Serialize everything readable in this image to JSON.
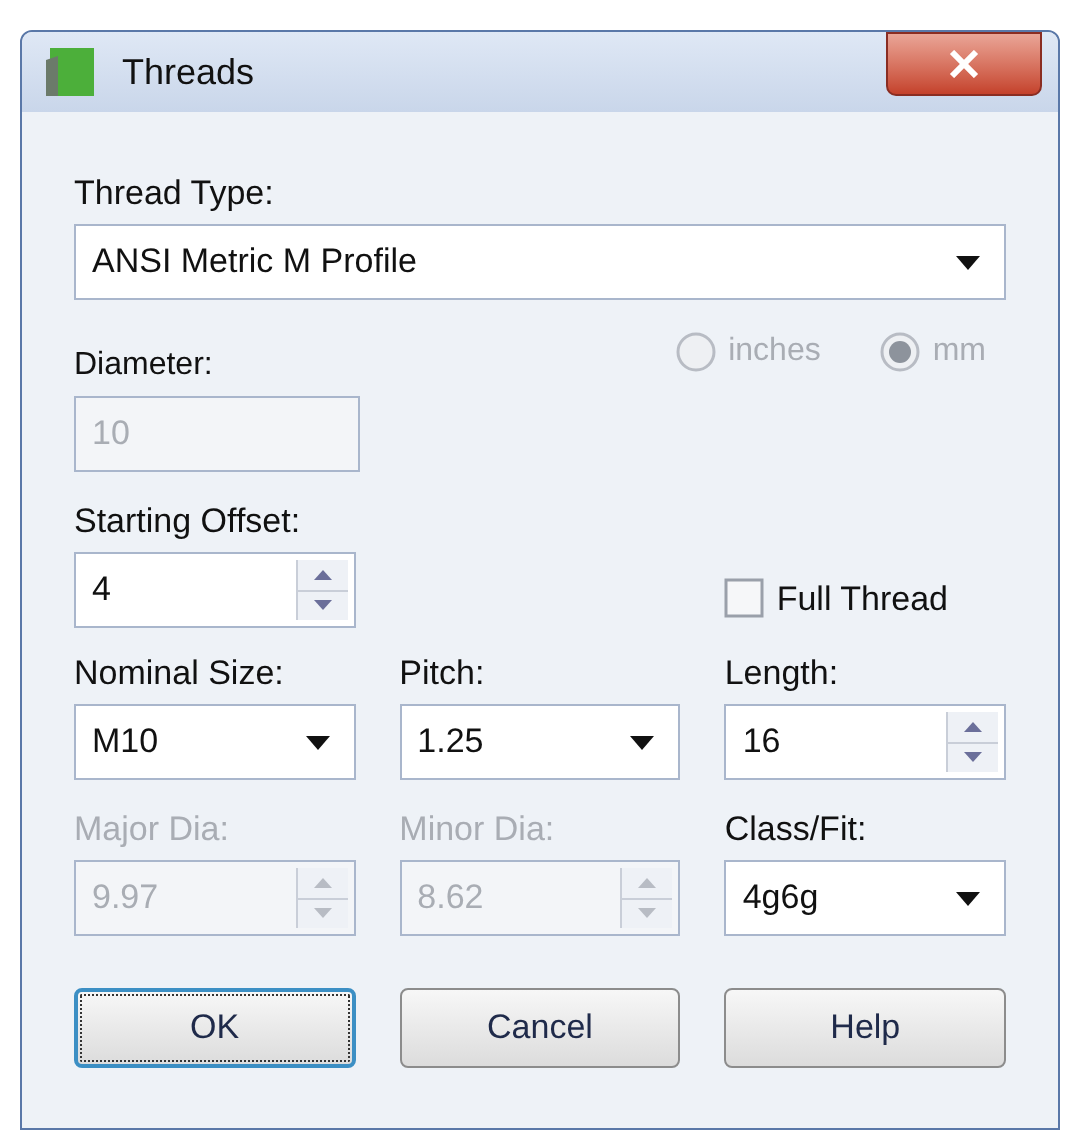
{
  "window": {
    "title": "Threads"
  },
  "thread_type": {
    "label": "Thread Type:",
    "value": "ANSI Metric M Profile"
  },
  "diameter": {
    "label": "Diameter:",
    "value": "10",
    "disabled": true
  },
  "units": [
    {
      "label": "inches",
      "selected": false,
      "disabled": true
    },
    {
      "label": "mm",
      "selected": true,
      "disabled": true
    }
  ],
  "starting_offset": {
    "label": "Starting Offset:",
    "value": "4"
  },
  "full_thread": {
    "label": "Full Thread",
    "checked": false
  },
  "fields": [
    {
      "label": "Nominal Size:",
      "kind": "dropdown",
      "value": "M10",
      "disabled": false
    },
    {
      "label": "Pitch:",
      "kind": "dropdown",
      "value": "1.25",
      "disabled": false
    },
    {
      "label": "Length:",
      "kind": "spin",
      "value": "16",
      "disabled": false
    },
    {
      "label": "Major Dia:",
      "kind": "spin",
      "value": "9.97",
      "disabled": true
    },
    {
      "label": "Minor Dia:",
      "kind": "spin",
      "value": "8.62",
      "disabled": true
    },
    {
      "label": "Class/Fit:",
      "kind": "dropdown",
      "value": "4g6g",
      "disabled": false
    }
  ],
  "buttons": [
    {
      "label": "OK",
      "focused": true
    },
    {
      "label": "Cancel",
      "focused": false
    },
    {
      "label": "Help",
      "focused": false
    }
  ]
}
